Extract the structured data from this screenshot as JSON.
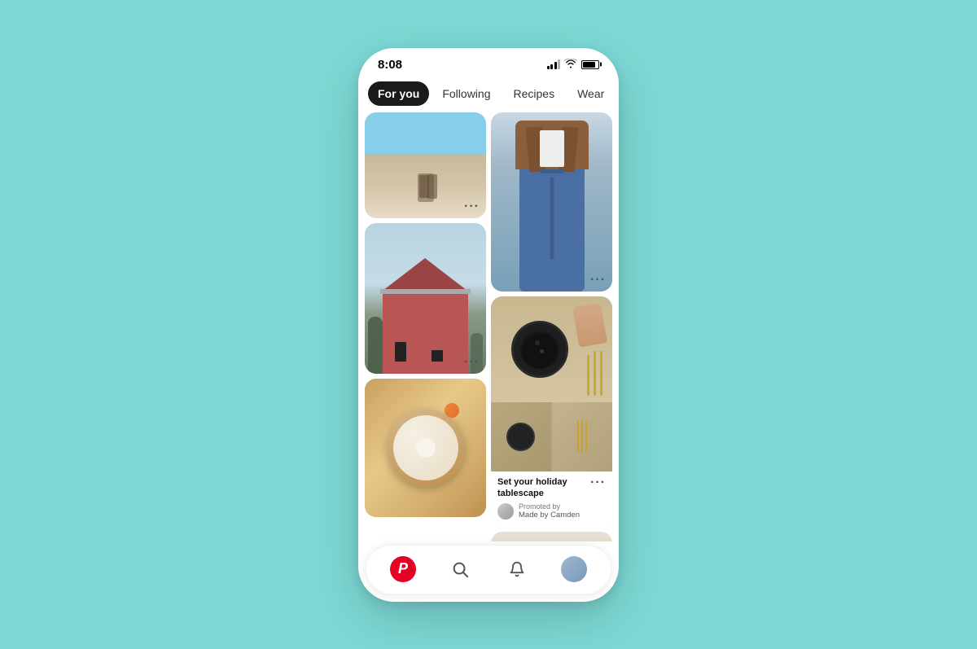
{
  "statusBar": {
    "time": "8:08"
  },
  "tabs": [
    {
      "id": "for-you",
      "label": "For you",
      "active": true
    },
    {
      "id": "following",
      "label": "Following",
      "active": false
    },
    {
      "id": "recipes",
      "label": "Recipes",
      "active": false
    },
    {
      "id": "wear",
      "label": "Wear",
      "active": false
    }
  ],
  "pins": {
    "col1": [
      {
        "id": "beach",
        "type": "beach",
        "hasMore": true
      },
      {
        "id": "house",
        "type": "house",
        "hasMore": true
      },
      {
        "id": "pie",
        "type": "pie",
        "hasMore": false
      }
    ],
    "col2": [
      {
        "id": "fashion",
        "type": "fashion",
        "hasMore": true
      },
      {
        "id": "tableware",
        "type": "tableware",
        "hasMore": true,
        "title": "Set your holiday tablescape",
        "promoted": true,
        "promotedLabel": "Promoted by",
        "promotedBy": "Made by Camden"
      },
      {
        "id": "room",
        "type": "room",
        "hasMore": false
      }
    ]
  },
  "bottomNav": {
    "items": [
      {
        "id": "home",
        "icon": "pinterest-logo"
      },
      {
        "id": "search",
        "icon": "search"
      },
      {
        "id": "bell",
        "icon": "bell"
      },
      {
        "id": "profile",
        "icon": "avatar"
      }
    ]
  }
}
